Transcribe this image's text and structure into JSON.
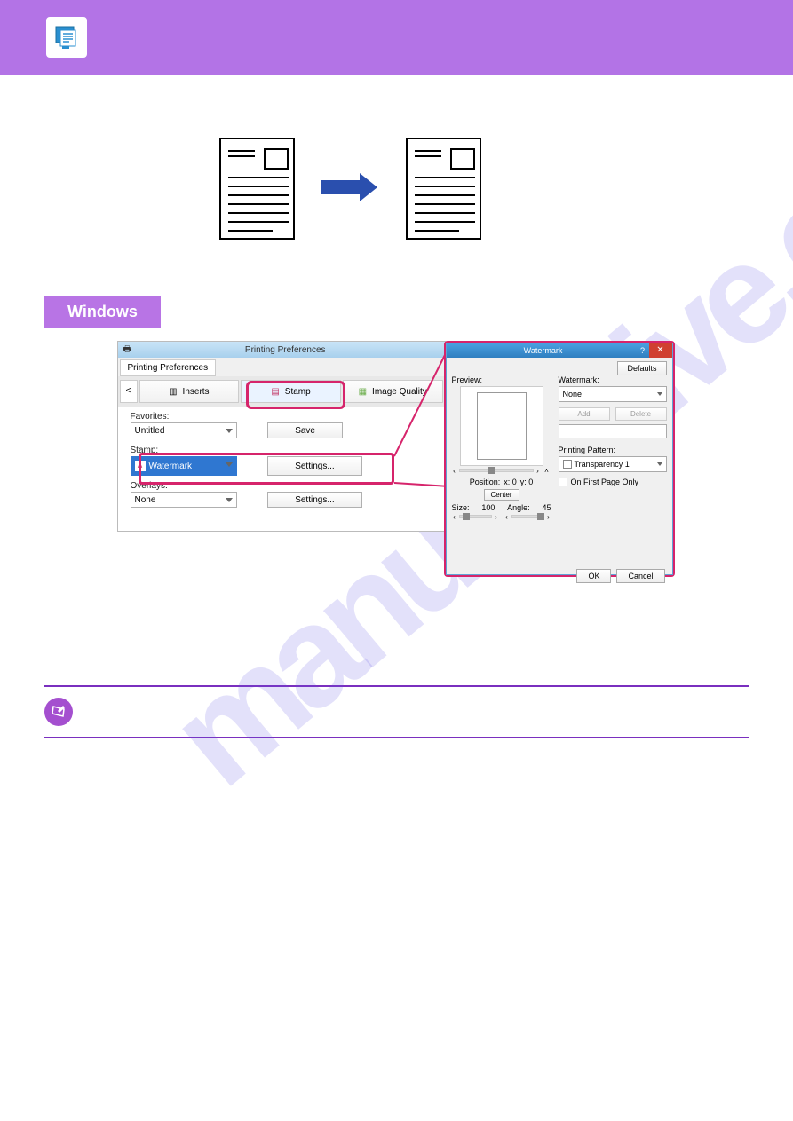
{
  "blankHeader": "",
  "diagram": {
    "arrow": "→"
  },
  "tag": "Windows",
  "mainWindow": {
    "title": "Printing Preferences",
    "tab": "Printing Preferences",
    "nav": "<",
    "toolbarButtons": {
      "inserts": "Inserts",
      "stamp": "Stamp",
      "imageQuality": "Image Quality"
    },
    "favoritesLabel": "Favorites:",
    "favoritesValue": "Untitled",
    "saveBtn": "Save",
    "stampLabel": "Stamp:",
    "stampValue": "Watermark",
    "settingsBtn": "Settings...",
    "overlaysLabel": "Overlays:",
    "overlaysValue": "None",
    "settingsBtn2": "Settings..."
  },
  "dialog": {
    "title": "Watermark",
    "defaults": "Defaults",
    "previewLabel": "Preview:",
    "positionLabel": "Position:",
    "posx": "x:   0",
    "posy": "y:   0",
    "centerBtn": "Center",
    "sizeLabel": "Size:",
    "sizeVal": "100",
    "angleLabel": "Angle:",
    "angleVal": "45",
    "watermarkLabel": "Watermark:",
    "watermarkValue": "None",
    "addBtn": "Add",
    "deleteBtn": "Delete",
    "patternLabel": "Printing Pattern:",
    "patternValue": "Transparency 1",
    "firstPage": "On First Page Only",
    "okBtn": "OK",
    "cancelBtn": "Cancel"
  },
  "bgWatermark": "manualshive.com"
}
